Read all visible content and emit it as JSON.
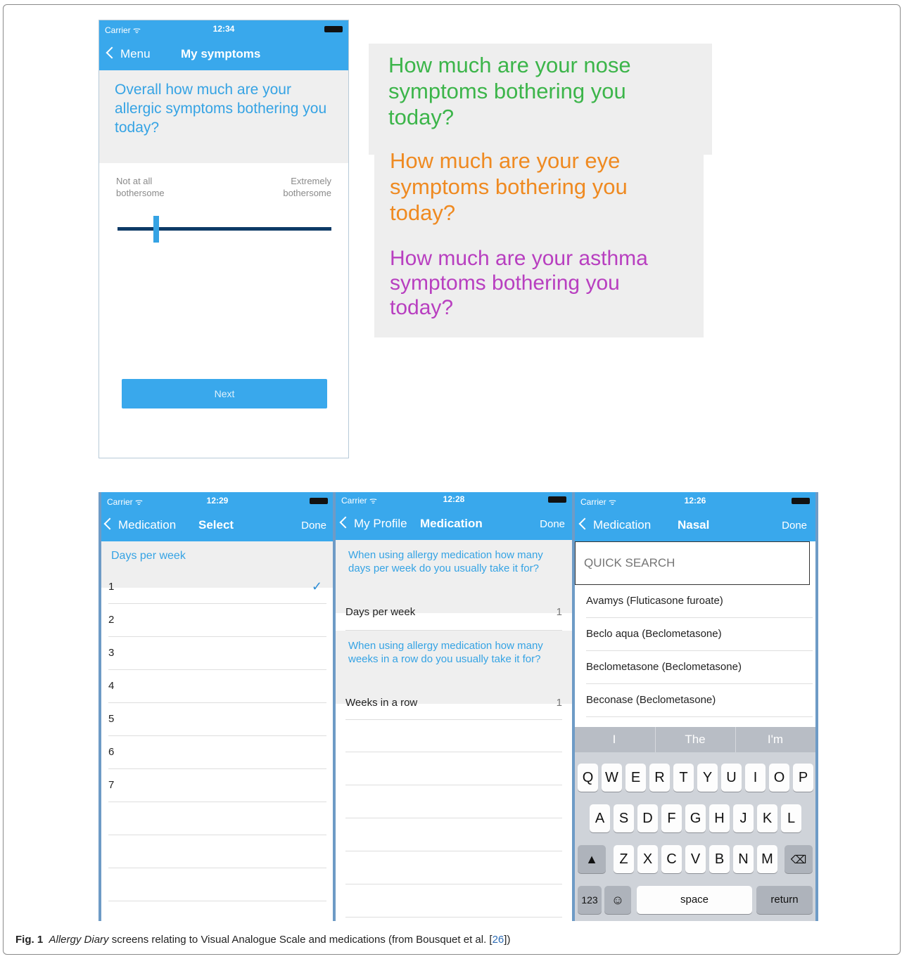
{
  "phone1": {
    "status": {
      "carrier": "Carrier ᯤ",
      "time": "12:34"
    },
    "back_label": "Menu",
    "title": "My symptoms",
    "question": "Overall how much are your allergic symptoms bothering you today?",
    "scale_left": "Not at all bothersome",
    "scale_right": "Extremely bothersome",
    "slider_value_percent": 18,
    "next_label": "Next"
  },
  "questions": [
    {
      "text": "How much are your nose symptoms bothering you today?",
      "color": "#3cb54a"
    },
    {
      "text": "How much are your eye symptoms bothering you today?",
      "color": "#ef8a21"
    },
    {
      "text": "How much are your asthma symptoms bothering you today?",
      "color": "#b83fc0"
    }
  ],
  "phone2": {
    "status": {
      "carrier": "Carrier ᯤ",
      "time": "12:29"
    },
    "back_label": "Medication",
    "title": "Select",
    "done_label": "Done",
    "section_header": "Days per week",
    "options": [
      "1",
      "2",
      "3",
      "4",
      "5",
      "6",
      "7"
    ],
    "selected": "1"
  },
  "phone3": {
    "status": {
      "carrier": "Carrier ᯤ",
      "time": "12:28"
    },
    "back_label": "My Profile",
    "title": "Medication",
    "done_label": "Done",
    "q1": "When using allergy medication how many days per week do you usually take it for?",
    "row1_label": "Days per week",
    "row1_value": "1",
    "q2": "When using allergy medication how many weeks in a row do you usually take it for?",
    "row2_label": "Weeks in a row",
    "row2_value": "1"
  },
  "phone4": {
    "status": {
      "carrier": "Carrier ᯤ",
      "time": "12:26"
    },
    "back_label": "Medication",
    "title": "Nasal",
    "done_label": "Done",
    "search_placeholder": "QUICK SEARCH",
    "results": [
      "Avamys (Fluticasone furoate)",
      "Beclo aqua (Beclometasone)",
      "Beclometasone (Beclometasone)",
      "Beconase (Beclometasone)"
    ],
    "suggestions": [
      "I",
      "The",
      "I'm"
    ],
    "row1": [
      "Q",
      "W",
      "E",
      "R",
      "T",
      "Y",
      "U",
      "I",
      "O",
      "P"
    ],
    "row2": [
      "A",
      "S",
      "D",
      "F",
      "G",
      "H",
      "J",
      "K",
      "L"
    ],
    "row3": [
      "Z",
      "X",
      "C",
      "V",
      "B",
      "N",
      "M"
    ],
    "key_123": "123",
    "key_space": "space",
    "key_return": "return"
  },
  "caption": {
    "fig": "Fig. 1",
    "title": "Allergy Diary",
    "text": " screens relating to Visual Analogue Scale and medications (from Bousquet et al. [",
    "ref": "26",
    "end": "])"
  }
}
